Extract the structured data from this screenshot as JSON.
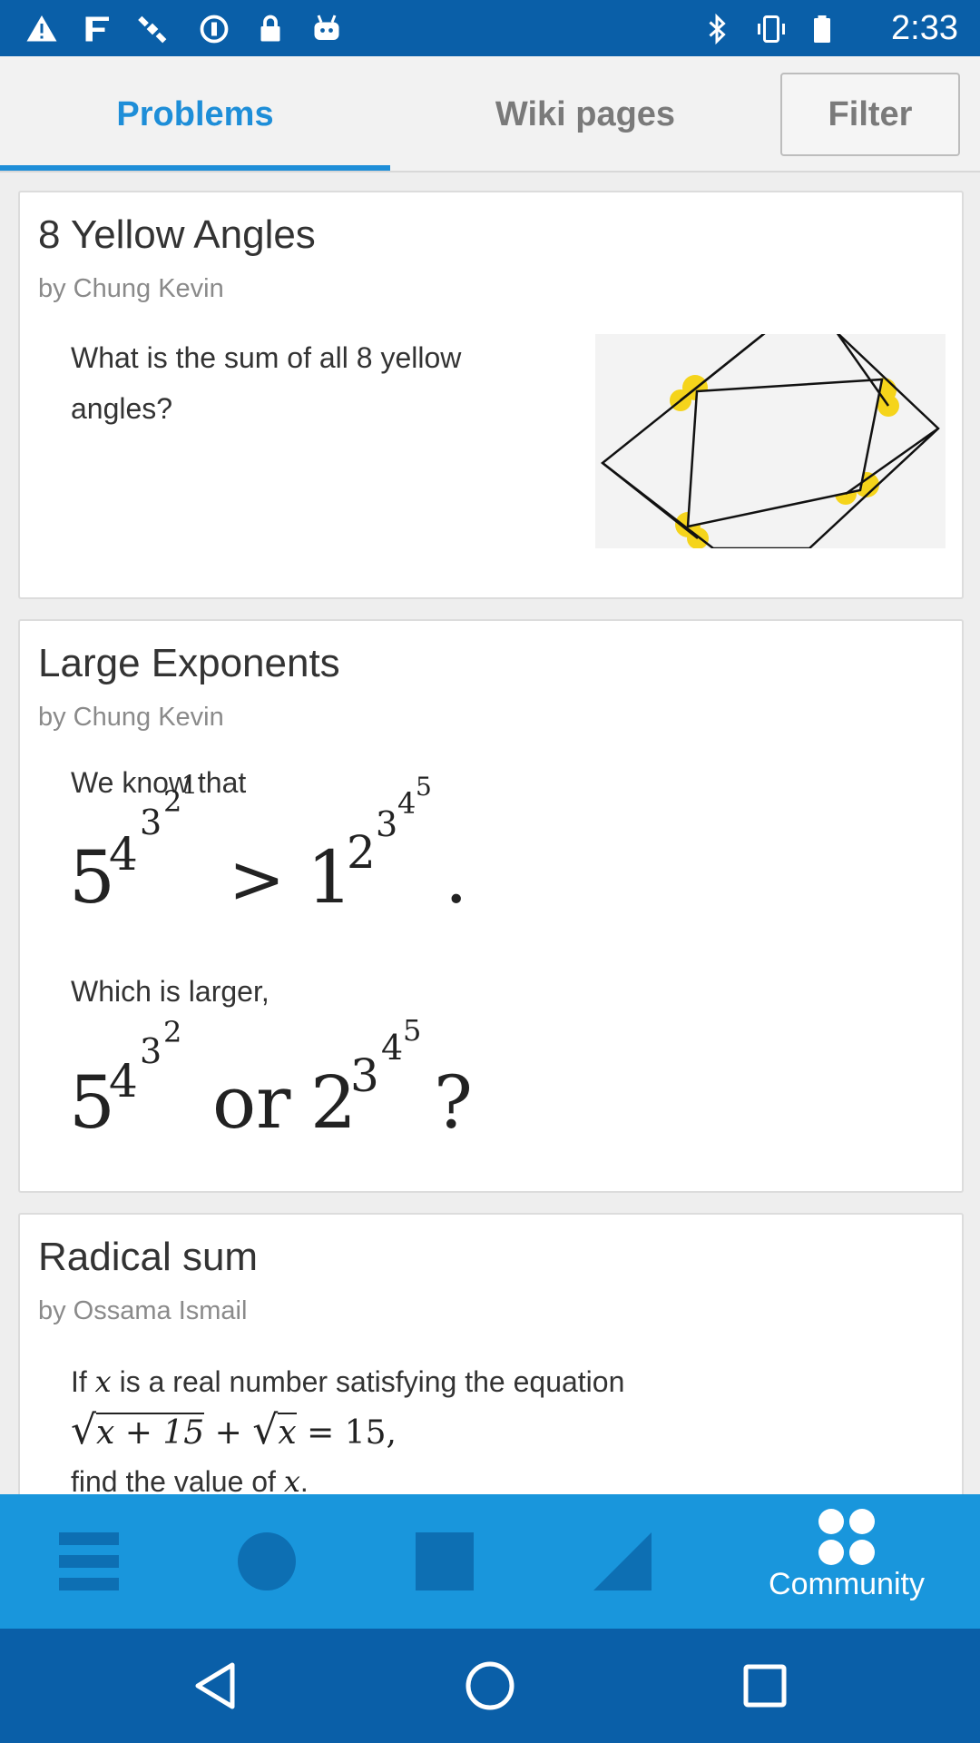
{
  "status_bar": {
    "time": "2:33",
    "icons": [
      "warning-icon",
      "fake-gps-icon",
      "satellite-icon",
      "data-saver-icon",
      "lock-icon",
      "android-icon",
      "bluetooth-icon",
      "vibrate-icon",
      "battery-icon"
    ]
  },
  "tabs": [
    {
      "label": "Problems",
      "active": true
    },
    {
      "label": "Wiki pages",
      "active": false
    }
  ],
  "filter_label": "Filter",
  "colors": {
    "accent": "#1e8ed8",
    "status_bar": "#0a5fa8",
    "bottom_nav": "#1996dc",
    "angle_marker": "#f5d41b"
  },
  "cards": [
    {
      "title": "8 Yellow Angles",
      "author": "by Chung Kevin",
      "body": "What is the sum of all 8 yellow angles?",
      "image": "yellow-angles-figure"
    },
    {
      "title": "Large Exponents",
      "author": "by Chung Kevin",
      "line1": "We know that",
      "eq1": {
        "base_left": "5",
        "exp_left": [
          "4",
          "3",
          "2",
          "1"
        ],
        "op": ">",
        "base_right": "1",
        "exp_right": [
          "2",
          "3",
          "4",
          "5"
        ],
        "end": "."
      },
      "line2": "Which is larger,",
      "eq2": {
        "base_left": "5",
        "exp_left": [
          "4",
          "3",
          "2"
        ],
        "mid": "or",
        "base_right": "2",
        "exp_right": [
          "3",
          "4",
          "5"
        ],
        "end": "?"
      }
    },
    {
      "title": "Radical sum",
      "author": "by Ossama Ismail",
      "line1_pre": "If ",
      "line1_var": "x",
      "line1_post": " is a real number satisfying the equation",
      "rad1": "x + 15",
      "plus": " + ",
      "rad2": "x",
      "eq_rhs": " = 15,",
      "line3_pre": "find the value of ",
      "line3_var": "x",
      "line3_post": "."
    }
  ],
  "bottom_nav": {
    "items": [
      "menu-icon",
      "circle-icon",
      "square-icon",
      "triangle-icon"
    ],
    "community_label": "Community"
  },
  "system_nav": [
    "back-button",
    "home-button",
    "recents-button"
  ]
}
